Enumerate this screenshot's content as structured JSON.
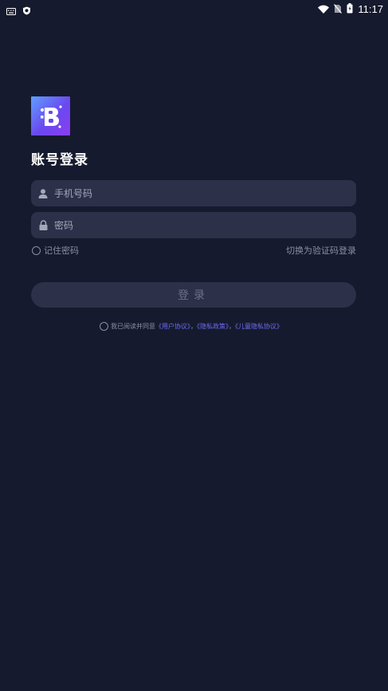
{
  "status_bar": {
    "time": "11:17",
    "left_icons": [
      "keyboard-icon",
      "shield-icon"
    ],
    "right_icons": [
      "wifi-icon",
      "no-sim-icon",
      "battery-icon"
    ]
  },
  "login": {
    "title": "账号登录",
    "phone_placeholder": "手机号码",
    "password_placeholder": "密码",
    "remember_label": "记住密码",
    "switch_label": "切换为验证码登录",
    "submit_label": "登录"
  },
  "agreement": {
    "prefix": "我已阅读并同意",
    "user_agreement": "《用户协议》",
    "sep1": "，",
    "privacy_policy": "《隐私政策》",
    "sep2": "，",
    "children_policy": "《儿童隐私协议》"
  },
  "colors": {
    "background": "#161a2e",
    "field_bg": "#2c3048",
    "link": "#6c6cf0",
    "muted_text": "#8a8ea3"
  }
}
